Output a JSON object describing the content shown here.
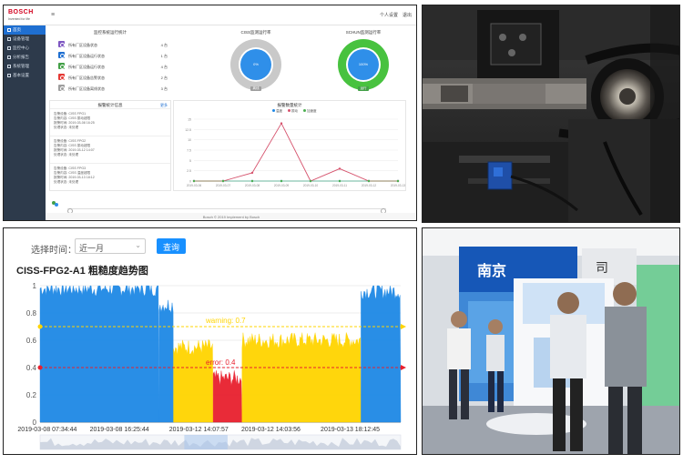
{
  "dashboard": {
    "brand": "BOSCH",
    "brand_sub": "Invented for life",
    "menu_toggle": "≡",
    "user_label": "个人设置",
    "logout_label": "退出",
    "sidebar": [
      {
        "label": "首页",
        "active": true
      },
      {
        "label": "设备管理",
        "active": false
      },
      {
        "label": "监控中心",
        "active": false
      },
      {
        "label": "分析报告",
        "active": false
      },
      {
        "label": "系统管理",
        "active": false
      },
      {
        "label": "基本设置",
        "active": false
      }
    ],
    "status_title": "监控系统运行统计",
    "status_rows": [
      {
        "label": "所有厂区设备状态",
        "count": "4 台",
        "color": "#7e57c2"
      },
      {
        "label": "所有厂区设备运行状态",
        "count": "1 台",
        "color": "#1f6fd1"
      },
      {
        "label": "所有厂区设备运行状态",
        "count": "4 台",
        "color": "#43a047"
      },
      {
        "label": "所有厂区设备告警状态",
        "count": "2 台",
        "color": "#e53935"
      },
      {
        "label": "所有厂区设备离线状态",
        "count": "3 台",
        "color": "#9e9e9e"
      }
    ],
    "gauges": [
      {
        "title": "CISS监测运行率",
        "value": "0%",
        "tag": "离线",
        "ring_color": "#c9c9c9",
        "tag_color": "#9e9e9e"
      },
      {
        "title": "SCHUN监测运行率",
        "value": "100%",
        "tag": "运行",
        "ring_color": "#48c23f",
        "tag_color": "#43a047"
      }
    ],
    "alarms_title": "报警统计信息",
    "alarms_more": "更多",
    "alarms": [
      [
        "告警设备: CISS FPG1",
        "告警内容: CISS 振动超限",
        "报警时间: 2019-03-08 16:25",
        "处理状态: 未处理"
      ],
      [
        "告警设备: CISS FPG2",
        "告警内容: CISS 振动超限",
        "报警时间: 2019-03-12 14:07",
        "处理状态: 未处理"
      ],
      [
        "告警设备: CISS FPG3",
        "告警内容: CISS 温度超限",
        "报警时间: 2019-03-13 18:12",
        "处理状态: 未处理"
      ]
    ],
    "chart_title": "报警数量统计",
    "chart_legend": [
      "温度",
      "振动",
      "加速度"
    ],
    "footer": "Bosch © 2019 Implement by Bosch"
  },
  "trend": {
    "query_label": "选择时间：",
    "range_value": "近一月",
    "query_button": "查询",
    "title": "CISS-FPG2-A1 粗糙度趋势图",
    "warning_label": "warning: 0.7",
    "error_label": "error: 0.4"
  },
  "colors": {
    "accent": "#1890ff",
    "normal": "#1e88e5",
    "warning": "#ffd400",
    "error": "#e8202e"
  },
  "chart_data": [
    {
      "type": "line",
      "title": "报警数量统计",
      "categories": [
        "2019-03-06",
        "2019-03-07",
        "2019-03-08",
        "2019-03-09",
        "2019-03-10",
        "2019-03-11",
        "2019-03-12",
        "2019-03-13"
      ],
      "series": [
        {
          "name": "温度",
          "values": [
            0,
            0,
            0,
            0,
            0,
            0,
            0,
            0
          ]
        },
        {
          "name": "振动",
          "values": [
            0,
            0,
            2,
            14,
            0,
            3,
            0,
            0
          ]
        },
        {
          "name": "加速度",
          "values": [
            0,
            0,
            0,
            0,
            0,
            0,
            0,
            0
          ]
        }
      ],
      "yticks": [
        0,
        2.5,
        5,
        7.5,
        10,
        12.5,
        15
      ],
      "ylim": [
        0,
        15
      ],
      "legend": "top"
    },
    {
      "type": "area",
      "title": "CISS-FPG2-A1 粗糙度趋势图",
      "x_ticks": [
        "2019-03-08 07:34:44",
        "2019-03-08 16:25:44",
        "2019-03-12 14:07:57",
        "2019-03-12 14:03:56",
        "2019-03-13 18:12:45"
      ],
      "yticks": [
        0,
        0.2,
        0.4,
        0.6,
        0.8,
        1
      ],
      "ylim": [
        0,
        1
      ],
      "thresholds": [
        {
          "name": "warning",
          "value": 0.7
        },
        {
          "name": "error",
          "value": 0.4
        }
      ],
      "segments": [
        {
          "x": [
            0.0,
            0.33
          ],
          "level": 0.98,
          "state": "normal"
        },
        {
          "x": [
            0.33,
            0.37
          ],
          "level": 0.86,
          "state": "normal"
        },
        {
          "x": [
            0.37,
            0.48
          ],
          "level": 0.55,
          "state": "warning"
        },
        {
          "x": [
            0.48,
            0.56
          ],
          "level": 0.32,
          "state": "error"
        },
        {
          "x": [
            0.56,
            0.89
          ],
          "level": 0.6,
          "state": "warning"
        },
        {
          "x": [
            0.89,
            1.0
          ],
          "level": 0.96,
          "state": "normal"
        }
      ]
    }
  ],
  "photos": {
    "machine_caption": "",
    "booth_sign": "南京",
    "booth_sign2": "司"
  }
}
